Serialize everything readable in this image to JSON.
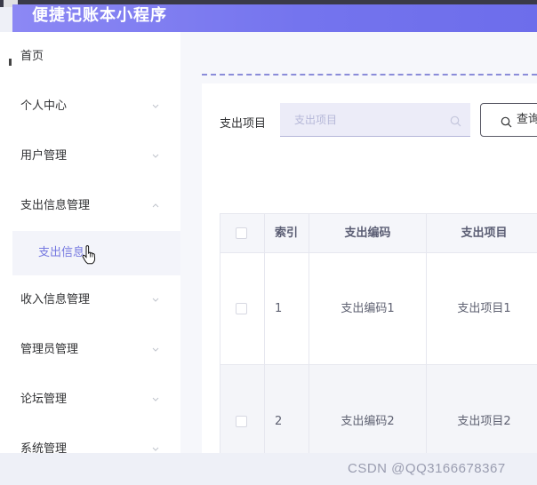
{
  "app": {
    "title": "便捷记账本小程序"
  },
  "sidebar": {
    "items": [
      {
        "label": "首页",
        "has_chevron": false
      },
      {
        "label": "个人中心",
        "has_chevron": true,
        "chevron": "down"
      },
      {
        "label": "用户管理",
        "has_chevron": true,
        "chevron": "down"
      },
      {
        "label": "支出信息管理",
        "has_chevron": true,
        "chevron": "up",
        "expanded": true
      },
      {
        "label": "收入信息管理",
        "has_chevron": true,
        "chevron": "down"
      },
      {
        "label": "管理员管理",
        "has_chevron": true,
        "chevron": "down"
      },
      {
        "label": "论坛管理",
        "has_chevron": true,
        "chevron": "down"
      },
      {
        "label": "系统管理",
        "has_chevron": true,
        "chevron": "down"
      }
    ],
    "submenu": {
      "label": "支出信息",
      "active": true
    }
  },
  "search": {
    "label": "支出项目",
    "placeholder": "支出项目",
    "value": "",
    "button_label": "查询",
    "icon": "search-icon"
  },
  "table": {
    "columns": [
      "索引",
      "支出编码",
      "支出项目"
    ],
    "rows": [
      {
        "index": "1",
        "code": "支出编码1",
        "item": "支出项目1"
      },
      {
        "index": "2",
        "code": "支出编码2",
        "item": "支出项目2"
      }
    ]
  },
  "colors": {
    "header_gradient_start": "#8c88f4",
    "header_gradient_end": "#6d6deb",
    "accent": "#7578e0",
    "dashed_line": "#8a8cd9"
  },
  "watermark": "CSDN @QQ3166678367"
}
